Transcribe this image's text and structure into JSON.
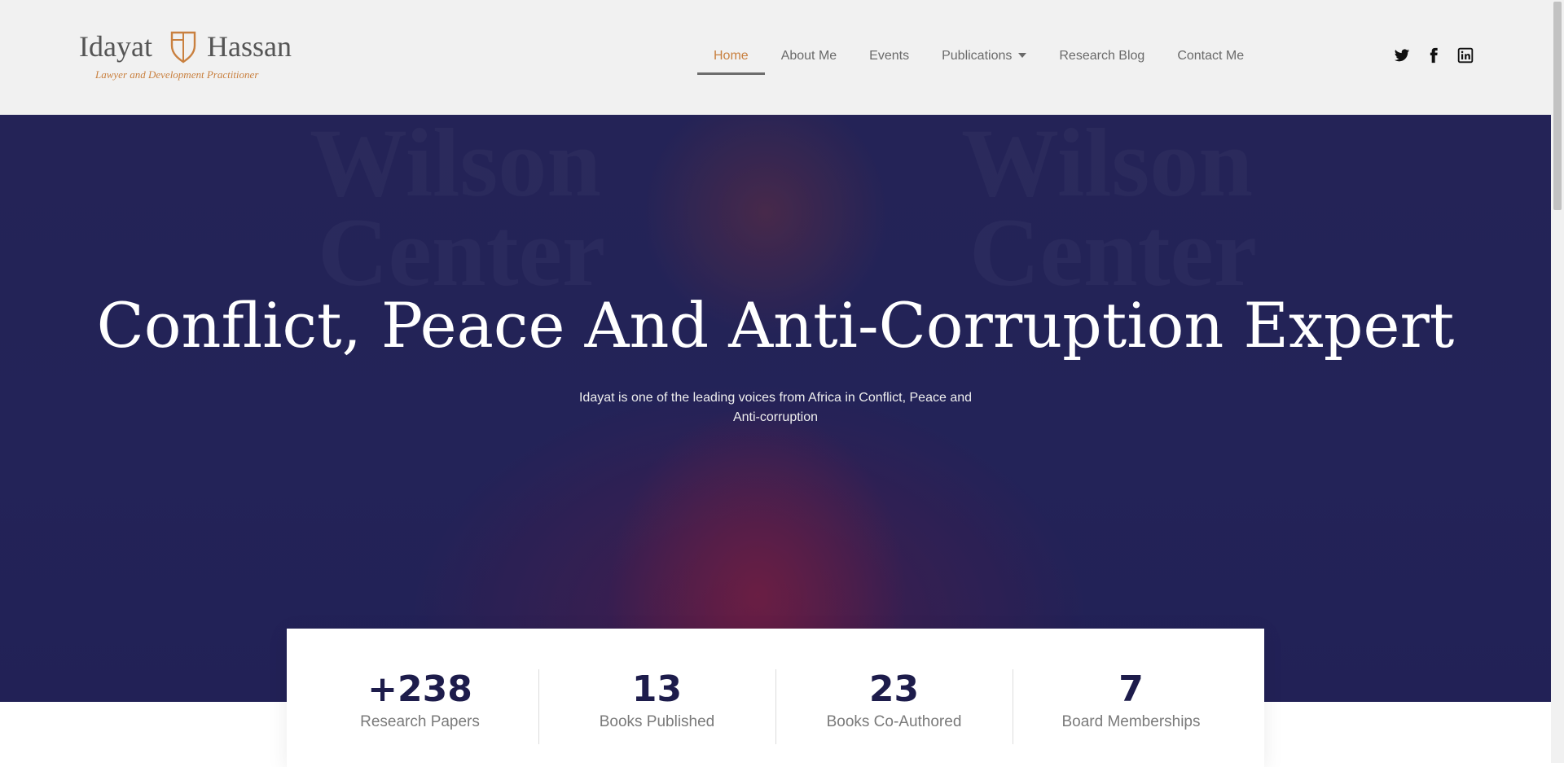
{
  "brand": {
    "first": "Idayat",
    "last": "Hassan",
    "tagline": "Lawyer and Development Practitioner",
    "accent_color": "#c9803f"
  },
  "nav": {
    "items": [
      {
        "label": "Home",
        "active": true
      },
      {
        "label": "About Me"
      },
      {
        "label": "Events"
      },
      {
        "label": "Publications",
        "has_dropdown": true
      },
      {
        "label": "Research Blog"
      },
      {
        "label": "Contact Me"
      }
    ]
  },
  "social": [
    "twitter-icon",
    "facebook-icon",
    "linkedin-icon"
  ],
  "hero": {
    "title": "Conflict, Peace And Anti-Corruption Expert",
    "subtitle": "Idayat is one of the leading voices from Africa in Conflict, Peace and Anti-corruption",
    "background_watermarks": [
      "Wilson",
      "Center",
      "Wilson",
      "Center"
    ]
  },
  "stats": [
    {
      "value": "+238",
      "label": "Research Papers"
    },
    {
      "value": "13",
      "label": "Books Published"
    },
    {
      "value": "23",
      "label": "Books Co-Authored"
    },
    {
      "value": "7",
      "label": "Board Memberships"
    }
  ],
  "colors": {
    "stat_value": "#1d1c4b",
    "hero_bg": "#24245a"
  }
}
